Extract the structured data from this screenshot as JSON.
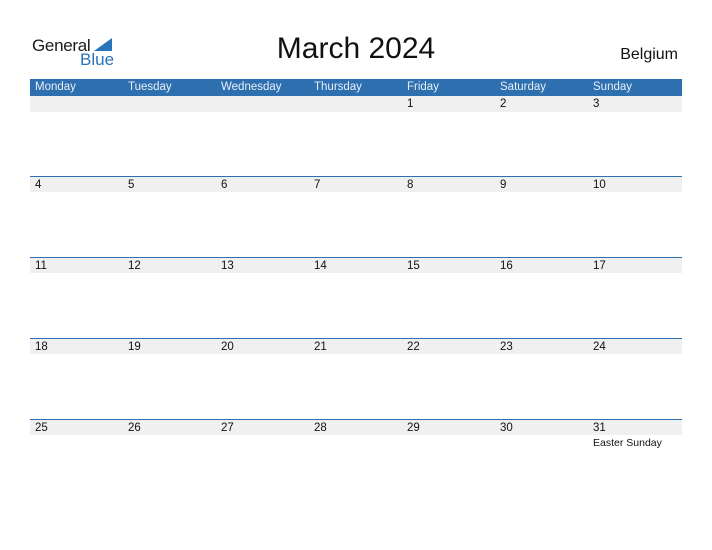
{
  "logo": {
    "line1": "General",
    "line2": "Blue",
    "accent": "#2a74b8"
  },
  "title": "March 2024",
  "country": "Belgium",
  "colors": {
    "header_bg": "#2e6fb0",
    "strip_bg": "#f0f0f0"
  },
  "weekdays": [
    "Monday",
    "Tuesday",
    "Wednesday",
    "Thursday",
    "Friday",
    "Saturday",
    "Sunday"
  ],
  "weeks": [
    {
      "days": [
        {
          "num": "",
          "event": ""
        },
        {
          "num": "",
          "event": ""
        },
        {
          "num": "",
          "event": ""
        },
        {
          "num": "",
          "event": ""
        },
        {
          "num": "1",
          "event": ""
        },
        {
          "num": "2",
          "event": ""
        },
        {
          "num": "3",
          "event": ""
        }
      ]
    },
    {
      "days": [
        {
          "num": "4",
          "event": ""
        },
        {
          "num": "5",
          "event": ""
        },
        {
          "num": "6",
          "event": ""
        },
        {
          "num": "7",
          "event": ""
        },
        {
          "num": "8",
          "event": ""
        },
        {
          "num": "9",
          "event": ""
        },
        {
          "num": "10",
          "event": ""
        }
      ]
    },
    {
      "days": [
        {
          "num": "11",
          "event": ""
        },
        {
          "num": "12",
          "event": ""
        },
        {
          "num": "13",
          "event": ""
        },
        {
          "num": "14",
          "event": ""
        },
        {
          "num": "15",
          "event": ""
        },
        {
          "num": "16",
          "event": ""
        },
        {
          "num": "17",
          "event": ""
        }
      ]
    },
    {
      "days": [
        {
          "num": "18",
          "event": ""
        },
        {
          "num": "19",
          "event": ""
        },
        {
          "num": "20",
          "event": ""
        },
        {
          "num": "21",
          "event": ""
        },
        {
          "num": "22",
          "event": ""
        },
        {
          "num": "23",
          "event": ""
        },
        {
          "num": "24",
          "event": ""
        }
      ]
    },
    {
      "days": [
        {
          "num": "25",
          "event": ""
        },
        {
          "num": "26",
          "event": ""
        },
        {
          "num": "27",
          "event": ""
        },
        {
          "num": "28",
          "event": ""
        },
        {
          "num": "29",
          "event": ""
        },
        {
          "num": "30",
          "event": ""
        },
        {
          "num": "31",
          "event": "Easter Sunday"
        }
      ]
    }
  ]
}
